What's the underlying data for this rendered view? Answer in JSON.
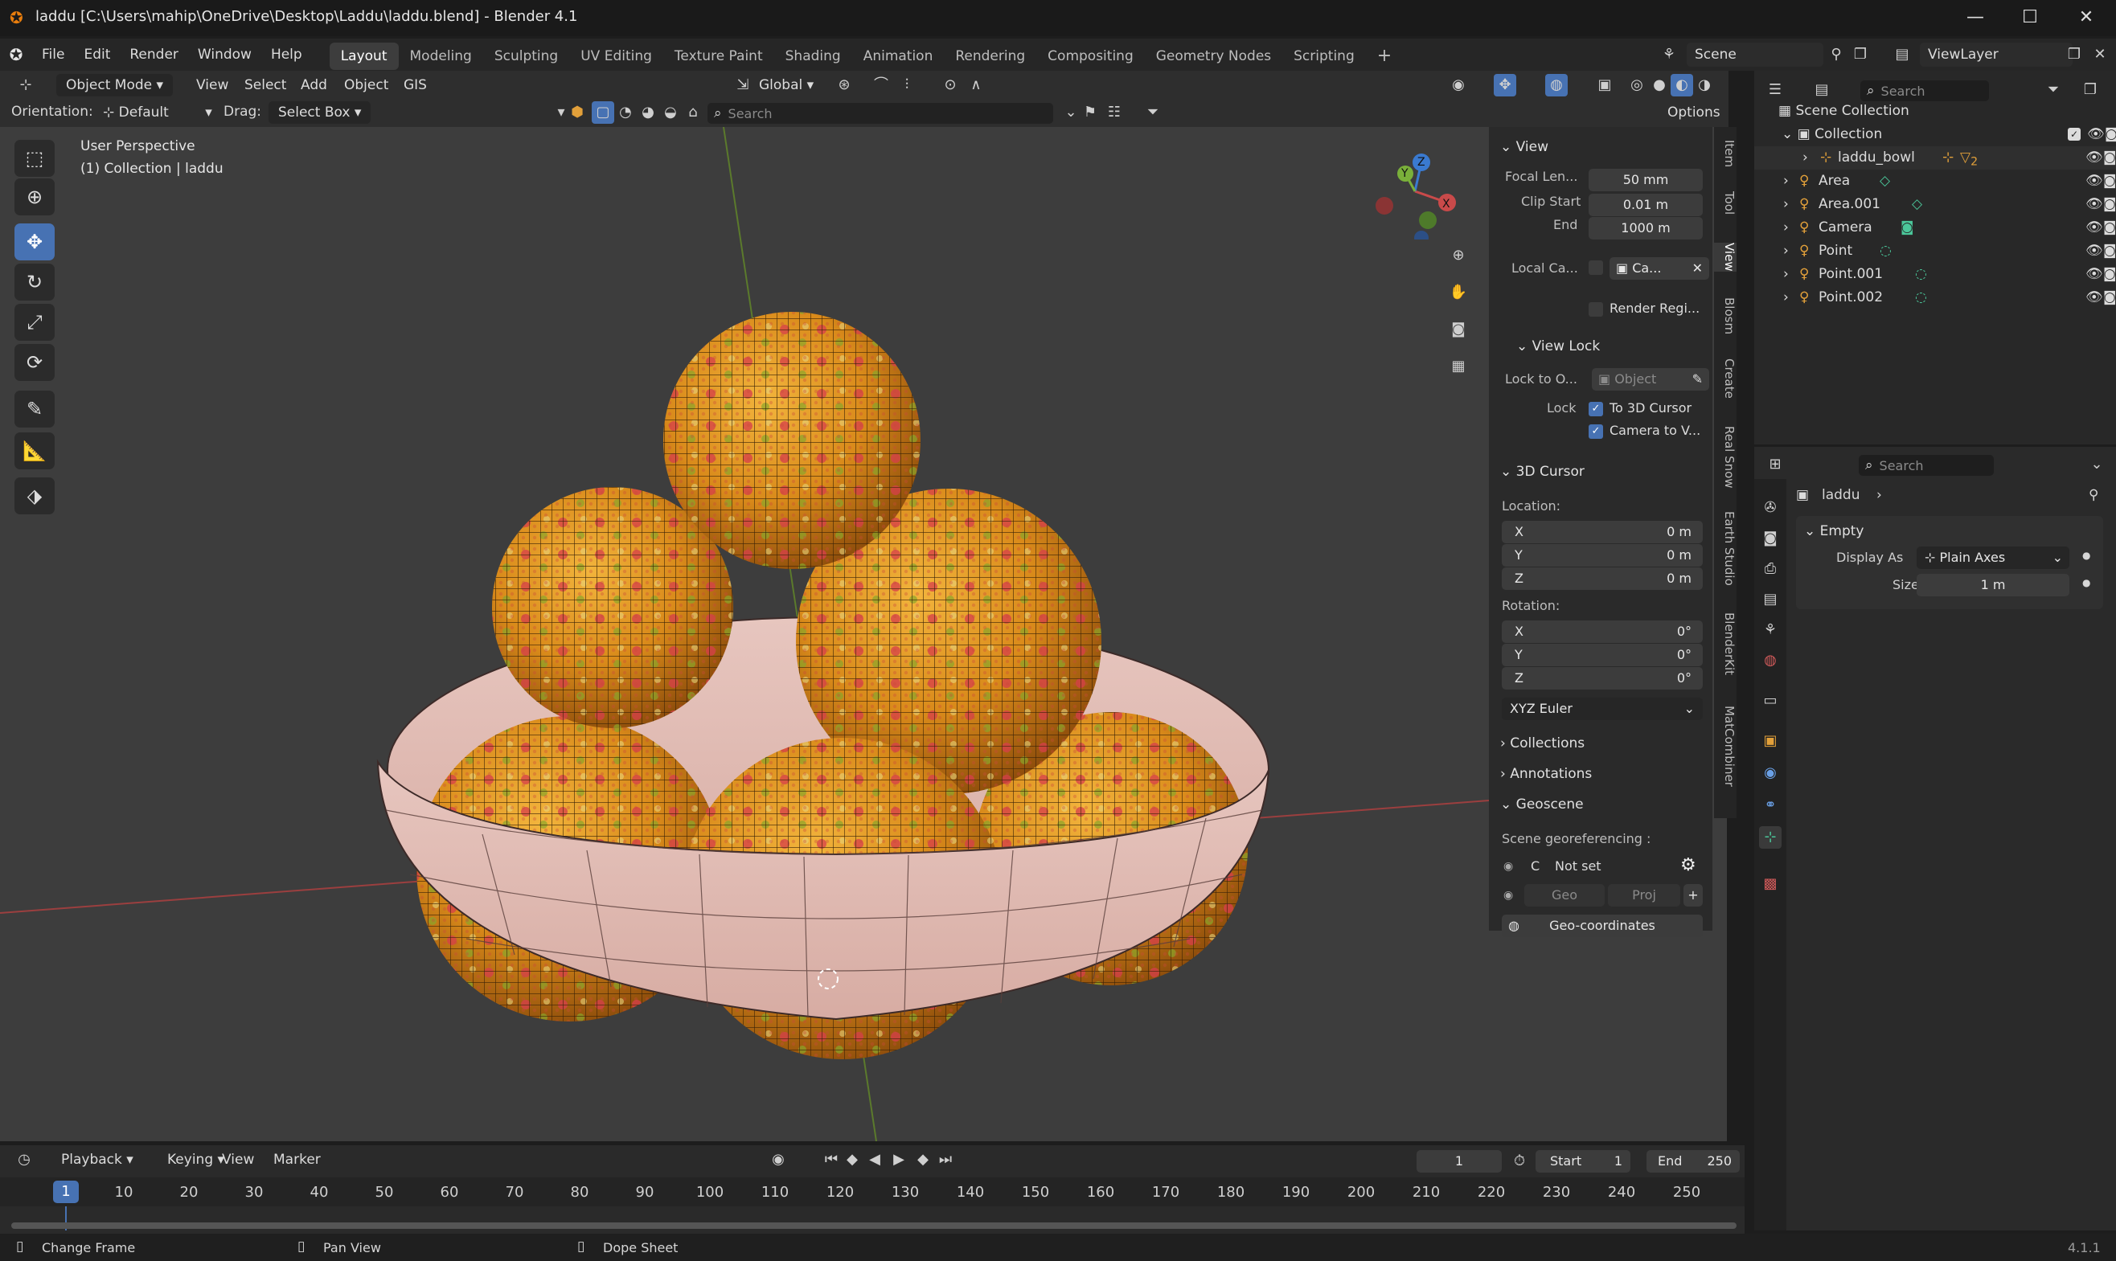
{
  "window": {
    "title": "laddu [C:\\Users\\mahip\\OneDrive\\Desktop\\Laddu\\laddu.blend] - Blender 4.1",
    "minimize": "—",
    "maximize": "☐",
    "close": "✕"
  },
  "menu": {
    "items": [
      "File",
      "Edit",
      "Render",
      "Window",
      "Help"
    ],
    "workspaces": [
      "Layout",
      "Modeling",
      "Sculpting",
      "UV Editing",
      "Texture Paint",
      "Shading",
      "Animation",
      "Rendering",
      "Compositing",
      "Geometry Nodes",
      "Scripting"
    ],
    "active_workspace": "Layout",
    "add_tab": "+",
    "scene": "Scene",
    "view_layer": "ViewLayer"
  },
  "viewport_header": {
    "mode": "Object Mode",
    "menus": [
      "View",
      "Select",
      "Add",
      "Object",
      "GIS"
    ],
    "transform_orientation": "Global",
    "orientation_label": "Orientation:",
    "orientation_value": "Default",
    "drag_label": "Drag:",
    "drag_value": "Select Box",
    "search_placeholder": "Search",
    "options": "Options"
  },
  "viewport": {
    "perspective": "User Perspective",
    "collection_info": "(1) Collection | laddu",
    "gizmo": {
      "x": "X",
      "y": "Y",
      "z": "Z"
    }
  },
  "npanel": {
    "view": {
      "header": "View",
      "focal_label": "Focal Len...",
      "focal_value": "50 mm",
      "clip_start_label": "Clip Start",
      "clip_start_value": "0.01 m",
      "end_label": "End",
      "end_value": "1000 m",
      "local_camera_label": "Local Ca...",
      "local_camera_value": "Ca...",
      "render_region": "Render Regi..."
    },
    "view_lock": {
      "header": "View Lock",
      "lock_to_label": "Lock to O...",
      "lock_to_value": "Object",
      "lock_label": "Lock",
      "to_cursor": "To 3D Cursor",
      "camera_to": "Camera to V..."
    },
    "cursor": {
      "header": "3D Cursor",
      "location_label": "Location:",
      "loc_x_label": "X",
      "loc_x": "0 m",
      "loc_y_label": "Y",
      "loc_y": "0 m",
      "loc_z_label": "Z",
      "loc_z": "0 m",
      "rotation_label": "Rotation:",
      "rot_x_label": "X",
      "rot_x": "0°",
      "rot_y_label": "Y",
      "rot_y": "0°",
      "rot_z_label": "Z",
      "rot_z": "0°",
      "rotation_mode": "XYZ Euler"
    },
    "collections": "Collections",
    "annotations": "Annotations",
    "geoscene": {
      "header": "Geoscene",
      "label": "Scene georeferencing :",
      "crs_letter": "C",
      "crs_value": "Not set",
      "geo": "Geo",
      "proj": "Proj",
      "plus": "+",
      "geo_coordinates": "Geo-coordinates"
    },
    "tabs": [
      "Item",
      "Tool",
      "View",
      "Blosm",
      "Create",
      "Real Snow",
      "Earth Studio",
      "BlenderKit",
      "MatCombiner"
    ]
  },
  "outliner": {
    "search_placeholder": "Search",
    "scene_collection": "Scene Collection",
    "collection": "Collection",
    "items": [
      "laddu_bowl",
      "Area",
      "Area.001",
      "Camera",
      "Point",
      "Point.001",
      "Point.002"
    ],
    "bowl_badge": "2"
  },
  "properties": {
    "search_placeholder": "Search",
    "object_name": "laddu",
    "section": "Empty",
    "display_as_label": "Display As",
    "display_as_value": "Plain Axes",
    "size_label": "Size",
    "size_value": "1 m"
  },
  "timeline": {
    "menus": [
      "Playback",
      "Keying",
      "View",
      "Marker"
    ],
    "current_frame": "1",
    "start_label": "Start",
    "start_value": "1",
    "end_label": "End",
    "end_value": "250",
    "ticks": [
      "10",
      "20",
      "30",
      "40",
      "50",
      "60",
      "70",
      "80",
      "90",
      "100",
      "110",
      "120",
      "130",
      "140",
      "150",
      "160",
      "170",
      "180",
      "190",
      "200",
      "210",
      "220",
      "230",
      "240",
      "250"
    ],
    "playhead": "1"
  },
  "statusbar": {
    "hint1": "Change Frame",
    "hint2": "Pan View",
    "hint3": "Dope Sheet",
    "version": "4.1.1"
  }
}
